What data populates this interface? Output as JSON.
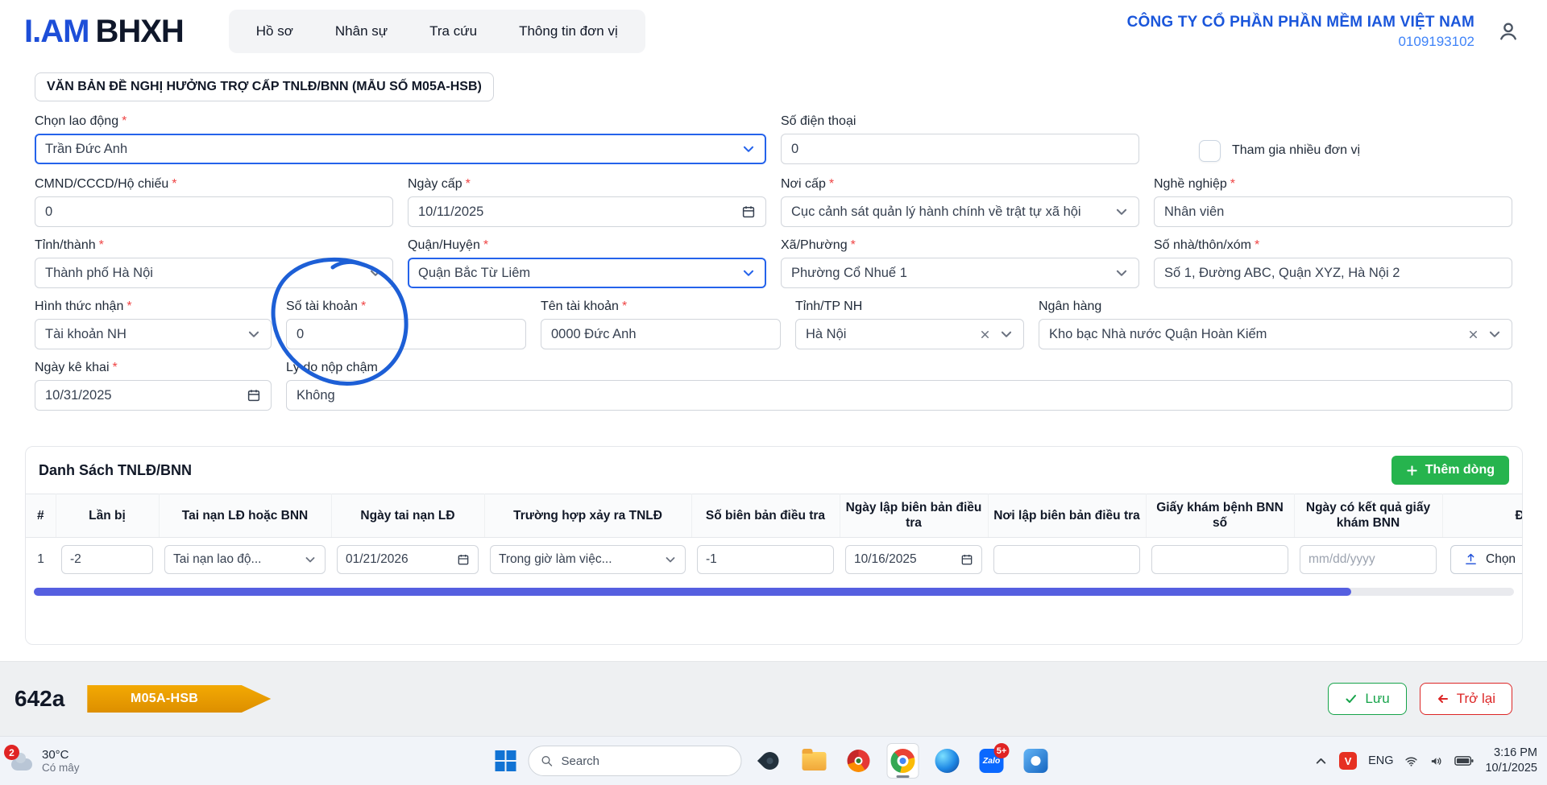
{
  "header": {
    "logo_primary": "I.AM",
    "logo_secondary": "BHXH",
    "nav": [
      {
        "label": "Hồ sơ"
      },
      {
        "label": "Nhân sự"
      },
      {
        "label": "Tra cứu"
      },
      {
        "label": "Thông tin đơn vị"
      }
    ],
    "company_name": "CÔNG TY CỔ PHẦN PHẦN MỀM IAM VIỆT NAM",
    "company_code": "0109193102"
  },
  "form": {
    "title": "VĂN BẢN ĐỀ NGHỊ HƯỞNG TRỢ CẤP TNLĐ/BNN (MẪU SỐ M05A-HSB)",
    "required_mark": "*",
    "fields": {
      "chon_lao_dong": {
        "label": "Chọn lao động",
        "value": "Trần Đức Anh"
      },
      "so_dien_thoai": {
        "label": "Số điện thoại",
        "value": "0"
      },
      "tham_gia_nhieu_don_vi": {
        "label": "Tham gia nhiều đơn vị",
        "checked": false
      },
      "cmnd": {
        "label": "CMND/CCCD/Hộ chiếu",
        "value": "0"
      },
      "ngay_cap": {
        "label": "Ngày cấp",
        "value": "10/11/2025"
      },
      "noi_cap": {
        "label": "Nơi cấp",
        "value": "Cục cảnh sát quản lý hành chính về trật tự xã hội"
      },
      "nghe_nghiep": {
        "label": "Nghề nghiệp",
        "value": "Nhân viên"
      },
      "tinh_thanh": {
        "label": "Tỉnh/thành",
        "value": "Thành phố Hà Nội"
      },
      "quan_huyen": {
        "label": "Quận/Huyện",
        "value": "Quận Bắc Từ Liêm"
      },
      "xa_phuong": {
        "label": "Xã/Phường",
        "value": "Phường Cổ Nhuế 1"
      },
      "so_nha": {
        "label": "Số nhà/thôn/xóm",
        "value": "Số 1, Đường ABC, Quận XYZ, Hà Nội 2"
      },
      "hinh_thuc_nhan": {
        "label": "Hình thức nhận",
        "value": "Tài khoản NH"
      },
      "so_tai_khoan": {
        "label": "Số tài khoản",
        "value": "0"
      },
      "ten_tai_khoan": {
        "label": "Tên tài khoản",
        "value": "0000 Đức Anh"
      },
      "tinh_tp_nh": {
        "label": "Tỉnh/TP NH",
        "value": "Hà Nội"
      },
      "ngan_hang": {
        "label": "Ngân hàng",
        "value": "Kho bạc Nhà nước Quận Hoàn Kiếm"
      },
      "ngay_ke_khai": {
        "label": "Ngày kê khai",
        "value": "10/31/2025"
      },
      "ly_do_nop_cham": {
        "label": "Lý do nộp chậm",
        "value": "Không"
      }
    }
  },
  "table": {
    "title": "Danh Sách TNLĐ/BNN",
    "add_row_label": "Thêm dòng",
    "columns": [
      "#",
      "Lần bị",
      "Tai nạn LĐ hoặc BNN",
      "Ngày tai nạn LĐ",
      "Trường hợp xảy ra TNLĐ",
      "Số biên bản điều tra",
      "Ngày lập biên bản điều tra",
      "Nơi lập biên bản điều tra",
      "Giấy khám bệnh BNN số",
      "Ngày có kết quả giấy khám BNN",
      "Đ"
    ],
    "rows": [
      {
        "stt": "1",
        "lan_bi": "-2",
        "tai_nan": "Tai nạn lao độ...",
        "ngay_tai_nan": "01/21/2026",
        "truong_hop": "Trong giờ làm việc...",
        "so_bien_ban": "-1",
        "ngay_lap_bb": "10/16/2025",
        "noi_lap_bb": "",
        "giay_kham_so": "",
        "ngay_kq_placeholder": "mm/dd/yyyy",
        "upload_label": "Chọn"
      }
    ]
  },
  "footer": {
    "page_code": "642a",
    "form_code": "M05A-HSB",
    "save_label": "Lưu",
    "back_label": "Trở lại"
  },
  "taskbar": {
    "weather_temp": "30°C",
    "weather_desc": "Có mây",
    "notification_badge": "2",
    "search_placeholder": "Search",
    "zalo_text": "Zalo",
    "zalo_badge": "5+",
    "v_icon_text": "V",
    "language": "ENG",
    "time": "3:16 PM",
    "date": "10/1/2025"
  },
  "annotation": {
    "type": "hand-drawn-circle",
    "target": "so_tai_khoan",
    "color": "#1d5fd6"
  },
  "colors": {
    "accent_blue": "#2563eb",
    "brand_blue": "#1a56db",
    "green_button": "#26b44e",
    "save_green": "#16a34a",
    "back_red": "#dc2626",
    "ribbon_orange": "#e89c00",
    "scrollbar_thumb": "#555fe0"
  }
}
